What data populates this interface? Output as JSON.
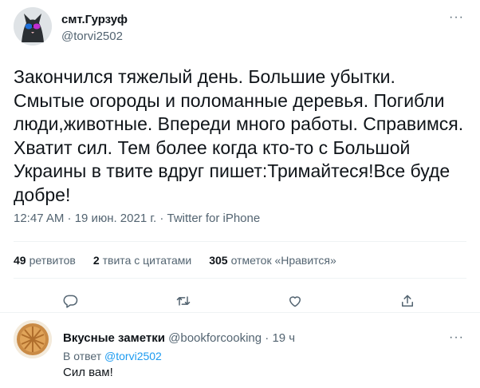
{
  "tweet": {
    "author": {
      "name": "смт.Гурзуф",
      "handle": "@torvi2502"
    },
    "more_label": "···",
    "text": "Закончился тяжелый день. Большие убытки. Смытые огороды и поломанные деревья. Погибли люди,животные. Впереди много работы. Справимся. Хватит сил. Тем более когда кто-то с Большой Украины в твите вдруг пишет:Тримайтеся!Все буде добре!",
    "meta": "12:47 AM · 19 июн. 2021 г. · Twitter for iPhone",
    "stats": [
      {
        "count": "49",
        "label": "ретвитов"
      },
      {
        "count": "2",
        "label": "твита с цитатами"
      },
      {
        "count": "305",
        "label": "отметок «Нравится»"
      }
    ],
    "actions": [
      "reply-icon",
      "retweet-icon",
      "like-icon",
      "share-icon"
    ]
  },
  "reply": {
    "name": "Вкусные заметки",
    "handle": "@bookforcooking",
    "dot": "·",
    "time": "19 ч",
    "reply_prefix": "В ответ",
    "reply_to": "@torvi2502",
    "text": "Сил вам!",
    "more_label": "···"
  },
  "colors": {
    "accent": "#1d9bf0",
    "secondary_text": "#536471",
    "primary_text": "#0f1419",
    "divider": "#eff3f4"
  }
}
